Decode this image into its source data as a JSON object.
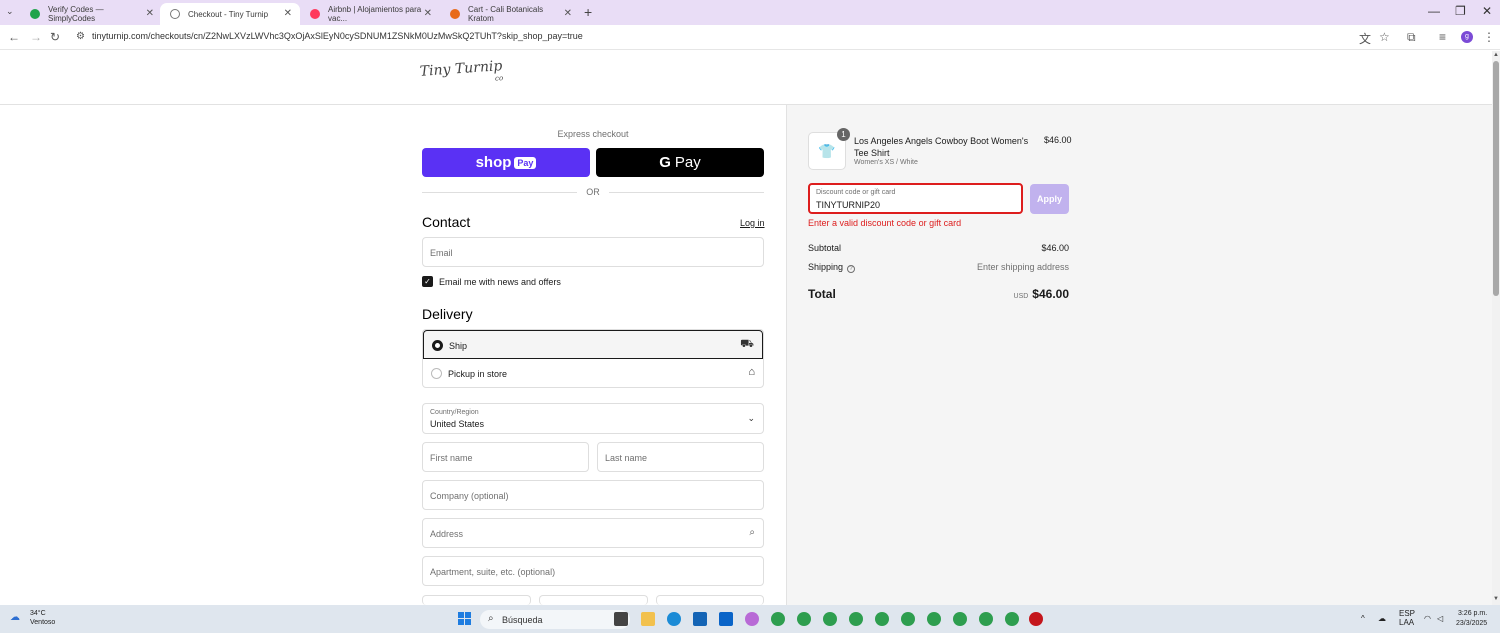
{
  "browser": {
    "tabs": [
      {
        "title": "Verify Codes — SimplyCodes",
        "color": "#1fa34a"
      },
      {
        "title": "Checkout - Tiny Turnip",
        "color": "#555555"
      },
      {
        "title": "Airbnb | Alojamientos para vac...",
        "color": "#ff385c"
      },
      {
        "title": "Cart - Cali Botanicals Kratom",
        "color": "#e86a1a"
      }
    ],
    "url": "tinyturnip.com/checkouts/cn/Z2NwLXVzLWVhc3QxOjAxSlEyN0cySDNUM1ZSNkM0UzMwSkQ2TUhT?skip_shop_pay=true"
  },
  "store": {
    "logo_text": "Tiny Turnip",
    "logo_sub": "co"
  },
  "express": {
    "label": "Express checkout",
    "shop_pay": "shop",
    "shop_pay_badge": "Pay",
    "google_pay_g": "G",
    "google_pay": "Pay",
    "or": "OR"
  },
  "contact": {
    "title": "Contact",
    "login": "Log in",
    "email_placeholder": "Email",
    "newsletter_label": "Email me with news and offers"
  },
  "delivery": {
    "title": "Delivery",
    "options": [
      {
        "label": "Ship",
        "selected": true
      },
      {
        "label": "Pickup in store",
        "selected": false
      }
    ],
    "country_label": "Country/Region",
    "country_value": "United States",
    "first_name": "First name",
    "last_name": "Last name",
    "company": "Company (optional)",
    "address": "Address",
    "apartment": "Apartment, suite, etc. (optional)"
  },
  "summary": {
    "qty": "1",
    "product_name": "Los Angeles Angels Cowboy Boot Women's Tee Shirt",
    "product_variant": "Women's XS / White",
    "product_price": "$46.00",
    "discount_label": "Discount code or gift card",
    "discount_value": "TINYTURNIP20",
    "apply": "Apply",
    "error": "Enter a valid discount code or gift card",
    "subtotal_label": "Subtotal",
    "subtotal_value": "$46.00",
    "shipping_label": "Shipping",
    "shipping_value": "Enter shipping address",
    "total_label": "Total",
    "currency": "USD",
    "total_value": "$46.00"
  },
  "taskbar": {
    "temp": "34°C",
    "condition": "Ventoso",
    "search": "Búsqueda",
    "lang1": "ESP",
    "lang2": "LAA",
    "time": "3:26 p.m.",
    "date": "23/3/2025"
  },
  "colors": {
    "accent": "#5a31f4",
    "error": "#dd1d1d",
    "apply_disabled": "#c1b2ee"
  }
}
